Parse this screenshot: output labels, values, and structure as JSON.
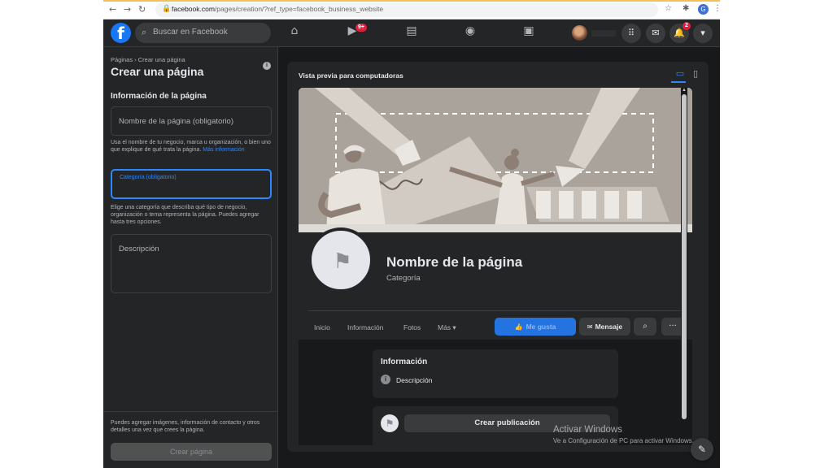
{
  "browser": {
    "url_host": "facebook.com",
    "url_path": "/pages/creation/?ref_type=facebook_business_website",
    "profile_initial": "G"
  },
  "topbar": {
    "search_placeholder": "Buscar en Facebook",
    "watch_badge": "9+",
    "notifications_badge": "2"
  },
  "sidebar": {
    "breadcrumb": "Páginas › Crear una página",
    "title": "Crear una página",
    "section_title": "Información de la página",
    "name_placeholder": "Nombre de la página (obligatorio)",
    "name_help": "Usa el nombre de tu negocio, marca u organización, o bien uno que explique de qué trata la página.",
    "name_help_link": "Más información",
    "category_placeholder": "Categoría (obligatorio)",
    "category_help": "Elige una categoría que describa qué tipo de negocio, organización o tema representa la página. Puedes agregar hasta tres opciones.",
    "description_placeholder": "Descripción",
    "footer_text": "Puedes agregar imágenes, información de contacto y otros detalles una vez que crees la página.",
    "create_button": "Crear página"
  },
  "preview": {
    "title": "Vista previa para computadoras",
    "page_name": "Nombre de la página",
    "category": "Categoría",
    "tabs": [
      "Inicio",
      "Información",
      "Fotos",
      "Más ▾"
    ],
    "like_button": "Me gusta",
    "message_button": "Mensaje",
    "info_card_title": "Información",
    "info_card_description": "Descripción",
    "create_post_button": "Crear publicación"
  },
  "watermark": {
    "line1": "Activar Windows",
    "line2": "Ve a Configuración de PC para activar Windows."
  },
  "colors": {
    "fb_blue": "#1877f2",
    "accent_blue": "#2d88ff",
    "dark_bg": "#18191a",
    "panel_bg": "#242526"
  }
}
